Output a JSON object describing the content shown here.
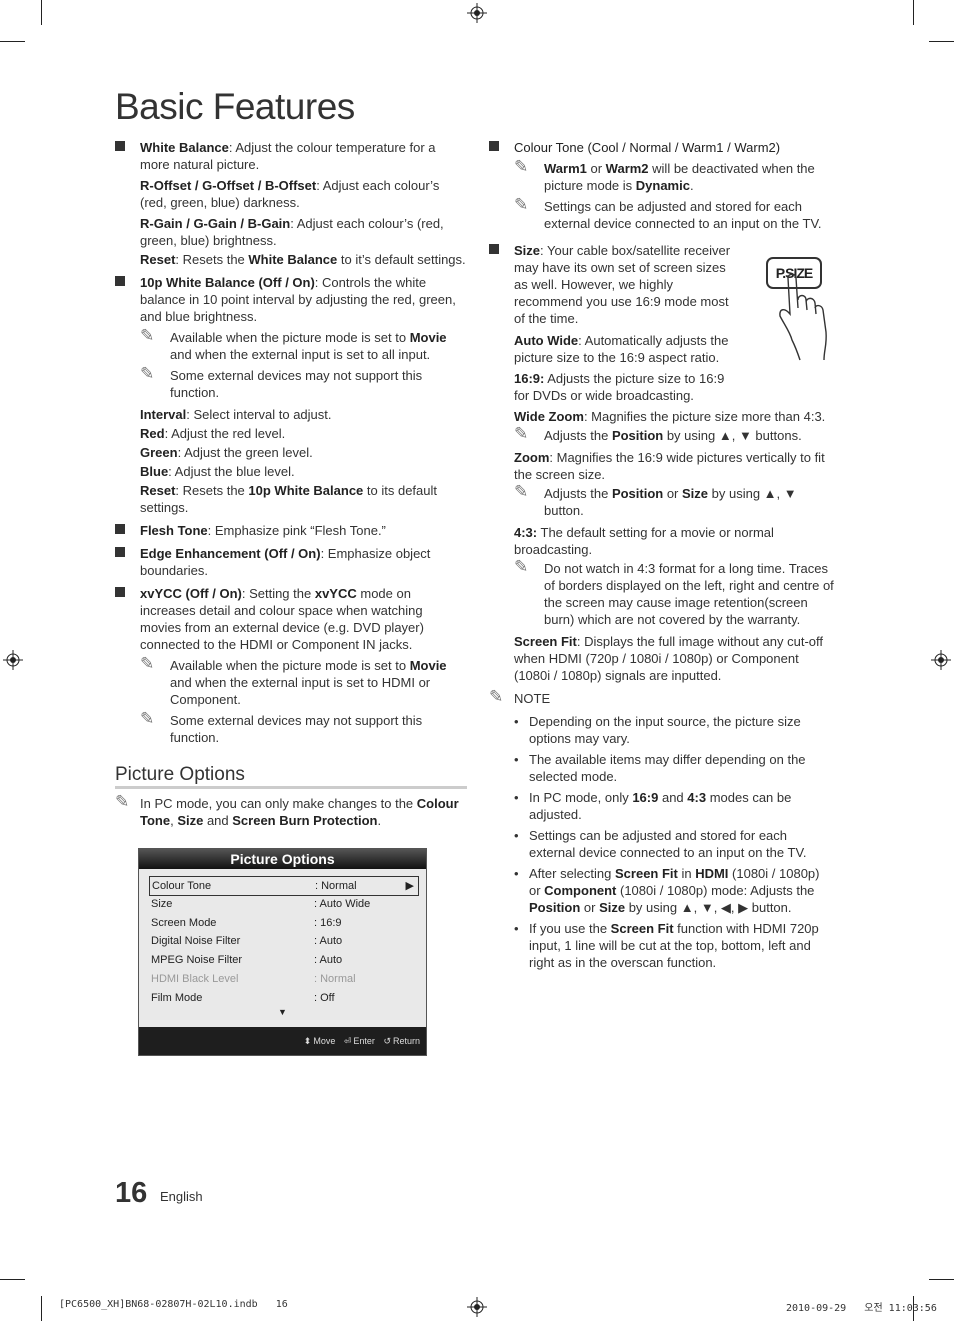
{
  "page": {
    "title": "Basic Features",
    "page_number": "16",
    "language": "English",
    "footer_file": "[PC6500_XH]BN68-02807H-02L10.indb   16",
    "footer_timestamp": "2010-09-29   오전 11:03:56"
  },
  "left": {
    "white_balance": {
      "term": "White Balance",
      "desc": ": Adjust the colour temperature for a more natural picture.",
      "sub": [
        {
          "term": "R-Offset / G-Offset / B-Offset",
          "desc": ": Adjust each colour’s (red, green, blue) darkness."
        },
        {
          "term": "R-Gain / G-Gain / B-Gain",
          "desc": ": Adjust each colour’s (red, green, blue) brightness."
        },
        {
          "term": "Reset",
          "desc1": ": Resets the ",
          "bold": "White Balance",
          "desc2": " to it’s default settings."
        }
      ]
    },
    "wb10p": {
      "term": "10p White Balance (Off / On)",
      "desc": ": Controls the white balance in 10 point interval by adjusting the red, green, and blue brightness.",
      "note1_a": "Available when the picture mode is set to ",
      "note1_b": "Movie",
      "note1_c": " and when the external input is set to all input.",
      "note2": "Some external devices may not support this function.",
      "sub": [
        {
          "term": "Interval",
          "desc": ": Select interval to adjust."
        },
        {
          "term": "Red",
          "desc": ": Adjust the red level."
        },
        {
          "term": "Green",
          "desc": ": Adjust the green level."
        },
        {
          "term": "Blue",
          "desc": ": Adjust the blue level."
        }
      ],
      "reset_term": "Reset",
      "reset_a": ": Resets the ",
      "reset_b": "10p White Balance",
      "reset_c": " to its default settings."
    },
    "flesh": {
      "term": "Flesh Tone",
      "desc": ": Emphasize pink “Flesh Tone.”"
    },
    "edge": {
      "term": "Edge Enhancement (Off / On)",
      "desc": ": Emphasize object boundaries."
    },
    "xvycc": {
      "term": "xvYCC (Off / On)",
      "desc_a": ": Setting the ",
      "desc_b": "xvYCC",
      "desc_c": " mode on increases detail and colour space when watching movies from an external device (e.g. DVD player) connected to the HDMI or Component IN jacks.",
      "note1_a": "Available when the picture mode is set to ",
      "note1_b": "Movie",
      "note1_c": " and when the external input is set to HDMI or Component.",
      "note2": "Some external devices may not support this function."
    },
    "picture_options": {
      "heading": "Picture Options",
      "note_a": "In PC mode, you can only make changes to the ",
      "note_b": "Colour Tone",
      "note_c": ", ",
      "note_d": "Size",
      "note_e": " and ",
      "note_f": "Screen Burn Protection",
      "note_g": "."
    }
  },
  "osd": {
    "title": "Picture Options",
    "rows": [
      {
        "label": "Colour Tone",
        "value": ": Normal",
        "selected": true
      },
      {
        "label": "Size",
        "value": ": Auto Wide"
      },
      {
        "label": "Screen Mode",
        "value": ": 16:9"
      },
      {
        "label": "Digital Noise Filter",
        "value": ": Auto"
      },
      {
        "label": "MPEG Noise Filter",
        "value": ": Auto"
      },
      {
        "label": "HDMI Black Level",
        "value": ": Normal",
        "disabled": true
      },
      {
        "label": "Film Mode",
        "value": ": Off"
      }
    ],
    "more_arrow": "▼",
    "selected_arrow": "▶",
    "footer": {
      "move": "Move",
      "enter": "Enter",
      "return": "Return"
    }
  },
  "right": {
    "colour_tone": {
      "term": "Colour Tone (Cool / Normal / Warm1 / Warm2)",
      "note1_a": "Warm1",
      "note1_b": " or ",
      "note1_c": "Warm2",
      "note1_d": " will be deactivated when the picture mode is ",
      "note1_e": "Dynamic",
      "note1_f": ".",
      "note2": "Settings can be adjusted and stored for each external device connected to an input on the TV."
    },
    "size": {
      "term": "Size",
      "desc": ": Your cable box/satellite receiver may have its own set of screen sizes as well. However, we highly recommend you use 16:9 mode most of the time.",
      "button_label": "P.SIZE",
      "auto_wide_term": "Auto Wide",
      "auto_wide_desc": ": Automatically adjusts the picture size to the 16:9 aspect ratio.",
      "r169_term": "16:9:",
      "r169_desc": " Adjusts the picture size to 16:9 for DVDs or wide broadcasting.",
      "wide_zoom_term": "Wide Zoom",
      "wide_zoom_desc": ": Magnifies the picture size more than 4:3.",
      "wz_note_a": "Adjusts the ",
      "wz_note_b": "Position",
      "wz_note_c": " by using ▲, ▼ buttons.",
      "zoom_term": "Zoom",
      "zoom_desc": ": Magnifies the 16:9 wide pictures vertically to fit the screen size.",
      "z_note_a": "Adjusts the ",
      "z_note_b": "Position",
      "z_note_c": " or ",
      "z_note_d": "Size",
      "z_note_e": " by using ▲, ▼ button.",
      "r43_term": "4:3:",
      "r43_desc": " The default setting for a movie or normal broadcasting.",
      "r43_note": "Do not watch in 4:3 format for a long time. Traces of borders displayed on the left, right and centre of the screen may cause image retention(screen burn) which are not covered by the warranty.",
      "fit_term": "Screen Fit",
      "fit_desc": ": Displays the full image without any cut-off when HDMI (720p / 1080i / 1080p) or Component (1080i / 1080p) signals are inputted."
    },
    "note": {
      "label": "NOTE",
      "b1": "Depending on the input source, the picture size options may vary.",
      "b2": "The available items may differ depending on the selected mode.",
      "b3_a": "In PC mode, only ",
      "b3_b": "16:9",
      "b3_c": " and ",
      "b3_d": "4:3",
      "b3_e": " modes can be adjusted.",
      "b4": "Settings can be adjusted and stored for each external device connected to an input on the TV.",
      "b5_a": "After selecting ",
      "b5_b": "Screen Fit",
      "b5_c": " in ",
      "b5_d": "HDMI",
      "b5_e": " (1080i / 1080p) or ",
      "b5_f": "Component",
      "b5_g": " (1080i / 1080p) mode: Adjusts the ",
      "b5_h": "Position",
      "b5_i": " or ",
      "b5_j": "Size",
      "b5_k": " by using ▲, ▼, ◀, ▶ button.",
      "b6_a": "If you use the ",
      "b6_b": "Screen Fit",
      "b6_c": " function with HDMI 720p input, 1 line will be cut at the top, bottom, left and right as in the overscan function."
    }
  },
  "icons": {
    "pencil": "✎",
    "bullet": "•"
  }
}
